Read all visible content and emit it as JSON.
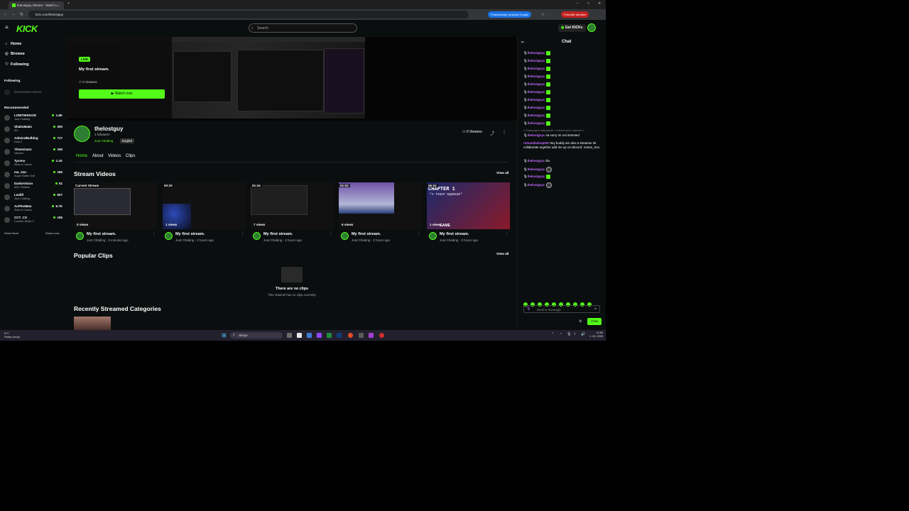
{
  "browser": {
    "tab_title": "thelostguy Stream - Watch Li...",
    "url": "kick.com/thelostguy",
    "translate_pill": "Podešavanje vpravbej Google",
    "profile_pill": "Potvrdite identitet"
  },
  "header": {
    "logo": "KICK",
    "search_placeholder": "Search",
    "get_kicks": "Get KICKs"
  },
  "sidebar": {
    "nav": [
      {
        "icon": "⌂",
        "label": "Home"
      },
      {
        "icon": "◎",
        "label": "Browse"
      },
      {
        "icon": "♡",
        "label": "Following"
      }
    ],
    "following_title": "Following",
    "following_item": "DementiveLostGuy",
    "recommended_title": "Recommended",
    "recommended": [
      {
        "name": "LOWTIERGOD",
        "category": "Just Chatting",
        "viewers": "1.8K"
      },
      {
        "name": "ShakoMako",
        "category": "IRL",
        "viewers": "300"
      },
      {
        "name": "AdmiralBulldog",
        "category": "Dota 2",
        "viewers": "717"
      },
      {
        "name": "ThisIsGator",
        "category": "Valheim",
        "viewers": "190"
      },
      {
        "name": "Tyceno",
        "category": "Slots & Casino",
        "viewers": "1.1K"
      },
      {
        "name": "ma_star",
        "category": "Super Battle Golf",
        "viewers": "180"
      },
      {
        "name": "DarkoVision",
        "category": "ARC Raiders",
        "viewers": "51"
      },
      {
        "name": "Leafill",
        "category": "Just Chatting",
        "viewers": "507"
      },
      {
        "name": "AcPlonMan",
        "category": "Slots & Casino",
        "viewers": "6.7K"
      },
      {
        "name": "CCT_CS",
        "category": "Counter-Strike 2",
        "viewers": "195"
      }
    ],
    "show_more": "Show More",
    "show_less": "Show Less"
  },
  "player": {
    "live_badge": "LIVE",
    "title": "My first stream.",
    "viewers": "0 Viewers",
    "watch_now": "▶ Watch now"
  },
  "channel": {
    "name": "thelostguy",
    "followers": "1 followers",
    "category": "Just Chatting",
    "language": "English",
    "viewers": "0 Viewers",
    "tabs": [
      "Home",
      "About",
      "Videos",
      "Clips"
    ]
  },
  "stream_videos": {
    "title": "Stream Videos",
    "view_all": "View all",
    "items": [
      {
        "label": "Current Stream",
        "views": "0 views",
        "title": "My first stream.",
        "meta": "Just Chatting · 3 minutes ago"
      },
      {
        "label": "00:20",
        "views": "1 views",
        "title": "My first stream.",
        "meta": "Just Chatting · 2 hours ago"
      },
      {
        "label": "01:34",
        "views": "7 views",
        "title": "My first stream.",
        "meta": "Just Chatting · 2 hours ago"
      },
      {
        "label": "01:02",
        "views": "6 views",
        "title": "My first stream.",
        "meta": "Just Chatting · 2 hours ago"
      },
      {
        "label": "05:02",
        "views": "1 views",
        "title": "My first stream.",
        "meta": "Just Chatting · 3 hours ago"
      }
    ]
  },
  "popular_clips": {
    "title": "Popular Clips",
    "view_all": "View all",
    "empty_title": "There are no clips",
    "empty_sub": "This channel has no clips currently"
  },
  "categories": {
    "title": "Recently Streamed Categories"
  },
  "thumb_text": {
    "chapter": "CHAPTER 1",
    "subtitle": "\"A TIGHT SQUEEZE\"",
    "game": "GAME"
  },
  "chat": {
    "title": "Chat",
    "messages": [
      {
        "user": "thelostguyc",
        "text": "",
        "emote": "green"
      },
      {
        "user": "thelostguyc",
        "text": "",
        "emote": "green"
      },
      {
        "user": "thelostguyc",
        "text": "",
        "emote": "green"
      },
      {
        "user": "thelostguyc",
        "text": "",
        "emote": "green"
      },
      {
        "user": "thelostguyc",
        "text": "",
        "emote": "green"
      },
      {
        "user": "thelostguyc",
        "text": "",
        "emote": "green"
      },
      {
        "user": "thelostguyc",
        "text": "",
        "emote": "green"
      },
      {
        "user": "thelostguyc",
        "text": "",
        "emote": "green"
      },
      {
        "user": "thelostguyc",
        "text": "",
        "emote": "green"
      },
      {
        "user": "thelostguyc",
        "text": "",
        "emote": "green"
      }
    ],
    "reply_note": "↳ Replying to kidpoyecki: I noticed your channel h...",
    "reply_msg": {
      "user": "thelostguyc",
      "text": "na sorry Im not intrested"
    },
    "long_msg": {
      "user": "romandsdoup00t",
      "text": "Hey buddy am also a streamer let collaborate together add me up on discord: roman_01a"
    },
    "thx_msg": {
      "user": "thelostguyc",
      "text": "thx"
    },
    "tail": [
      {
        "user": "thelostguyc",
        "emote": "round"
      },
      {
        "user": "thelostguyc",
        "emote": "green"
      },
      {
        "user": "thelostguyc",
        "emote": "round"
      }
    ],
    "input_placeholder": "Send a message",
    "send_label": "Chat"
  },
  "taskbar": {
    "weather_temp": "9°C",
    "weather_desc": "Partly sunny",
    "search": "Skraje",
    "time": "10:50",
    "date": "1. 03. 2026"
  }
}
